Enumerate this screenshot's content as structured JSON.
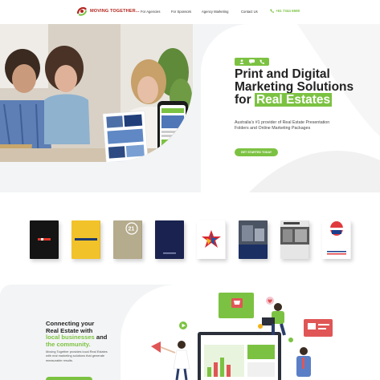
{
  "brand": {
    "name": "MOVING TOGETHER...",
    "accent": "#7cc242",
    "logo_red": "#b3261e"
  },
  "nav": {
    "links": [
      "For Agencies",
      "For Sponsors",
      "Agency Marketing",
      "Contact Us"
    ],
    "phone": "+61 7344 6590"
  },
  "hero": {
    "title_line1": "Print and Digital",
    "title_line2": "Marketing Solutions",
    "title_line3_prefix": "for ",
    "title_highlight": "Real Estates",
    "subtitle": "Australia's #1 provider of Real Estate Presentation Folders and Online Marketing Packages",
    "cta": "GET STARTED TODAY",
    "icons": [
      "person-icon",
      "chat-icon",
      "phone-icon"
    ]
  },
  "folders": [
    {
      "brand": "Ray White",
      "color": "#141414"
    },
    {
      "brand": "Harcourts",
      "color": "#f2c22a"
    },
    {
      "brand": "21",
      "color": "#b5ab8d"
    },
    {
      "brand": "",
      "color": "#1a2350"
    },
    {
      "brand": "",
      "color": "#ffffff"
    },
    {
      "brand": "",
      "color": "#e8e8e8"
    },
    {
      "brand": "",
      "color": "#e6e6e6"
    },
    {
      "brand": "RE/MAX",
      "color": "#ffffff"
    }
  ],
  "community": {
    "title_line1": "Connecting your",
    "title_line2": "Real Estate with",
    "title_green1": "local businesses",
    "title_and": " and",
    "title_green2": "the community.",
    "body": "Moving Together provides local Real Estates with real marketing solutions that generate measurable results."
  }
}
